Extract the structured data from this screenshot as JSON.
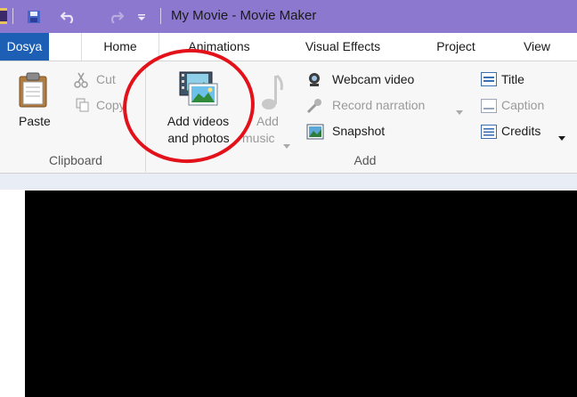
{
  "window": {
    "title": "My Movie - Movie Maker"
  },
  "tabs": [
    {
      "label": "Dosya"
    },
    {
      "label": "Home"
    },
    {
      "label": "Animations"
    },
    {
      "label": "Visual Effects"
    },
    {
      "label": "Project"
    },
    {
      "label": "View"
    }
  ],
  "ribbon": {
    "clipboard": {
      "label": "Clipboard",
      "paste": "Paste",
      "cut": "Cut",
      "copy": "Copy"
    },
    "add": {
      "label": "Add",
      "add_videos_line1": "Add videos",
      "add_videos_line2": "and photos",
      "add_music_line1": "Add",
      "add_music_line2": "music",
      "webcam": "Webcam video",
      "record_narration": "Record narration",
      "snapshot": "Snapshot",
      "title": "Title",
      "caption": "Caption",
      "credits": "Credits"
    }
  },
  "colors": {
    "titlebar": "#8c78cf",
    "file_tab": "#1c5fb4",
    "annotation": "#e3121a",
    "preview": "#000000"
  }
}
